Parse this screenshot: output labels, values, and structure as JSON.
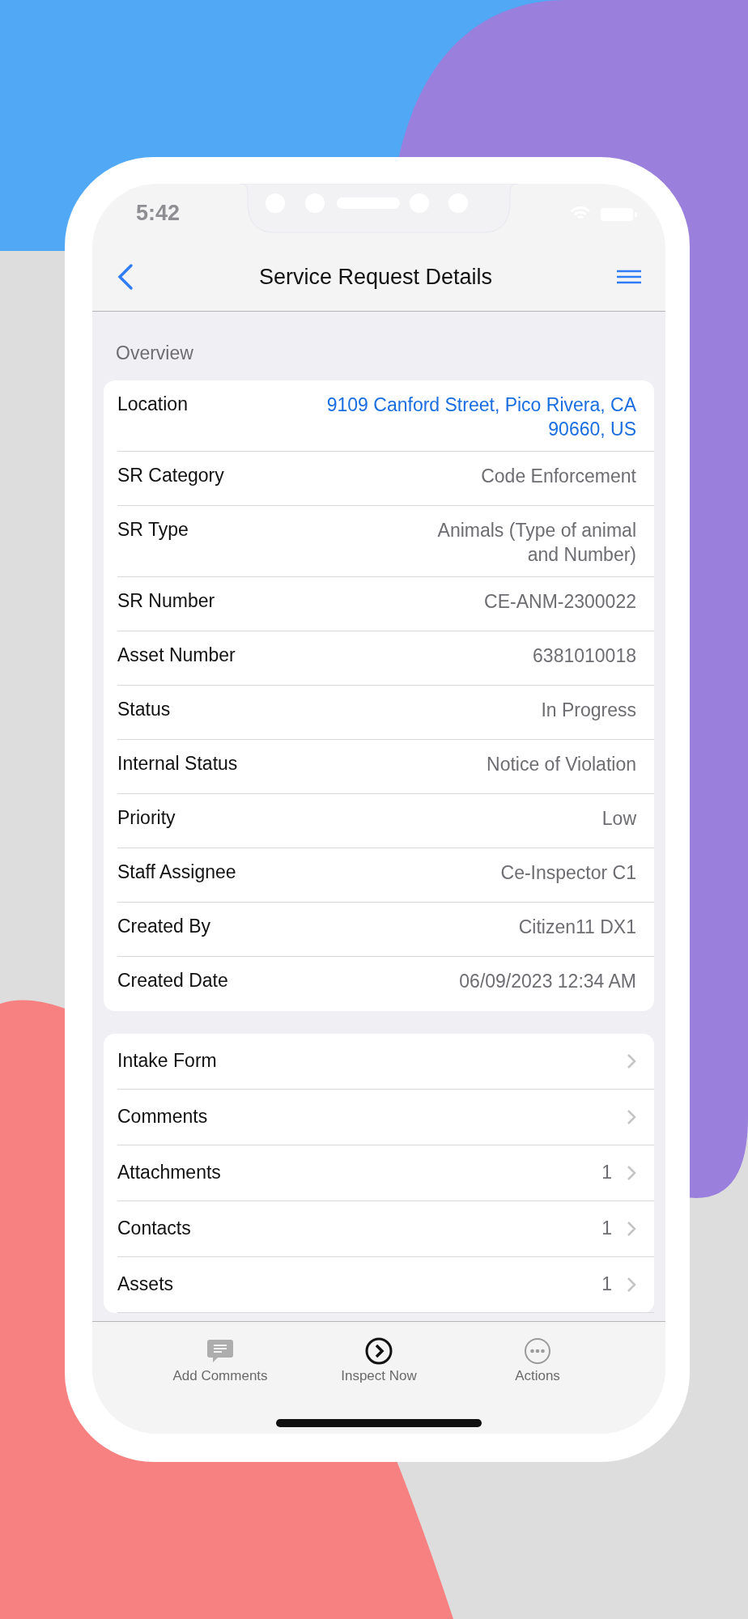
{
  "status_bar": {
    "time": "5:42"
  },
  "header": {
    "title": "Service Request Details"
  },
  "overview": {
    "title": "Overview",
    "rows": [
      {
        "label": "Location",
        "value": "9109 Canford Street, Pico Rivera, CA 90660, US",
        "kind": "link"
      },
      {
        "label": "SR Category",
        "value": "Code Enforcement",
        "kind": "text"
      },
      {
        "label": "SR Type",
        "value": "Animals (Type of animal and Number)",
        "kind": "text"
      },
      {
        "label": "SR Number",
        "value": "CE-ANM-2300022",
        "kind": "text"
      },
      {
        "label": "Asset Number",
        "value": "6381010018",
        "kind": "text"
      },
      {
        "label": "Status",
        "value": "In Progress",
        "kind": "text"
      },
      {
        "label": "Internal Status",
        "value": "Notice of Violation",
        "kind": "text"
      },
      {
        "label": "Priority",
        "value": "Low",
        "kind": "text"
      },
      {
        "label": "Staff Assignee",
        "value": "Ce-Inspector C1",
        "kind": "text"
      },
      {
        "label": "Created By",
        "value": "Citizen11 DX1",
        "kind": "text"
      },
      {
        "label": "Created Date",
        "value": "06/09/2023 12:34 AM",
        "kind": "text"
      }
    ]
  },
  "sections": [
    {
      "label": "Intake Form"
    },
    {
      "label": "Comments"
    },
    {
      "label": "Attachments",
      "count": "1"
    },
    {
      "label": "Contacts",
      "count": "1"
    },
    {
      "label": "Assets",
      "count": "1"
    }
  ],
  "tab_bar": [
    {
      "label": "Add Comments",
      "selected": false
    },
    {
      "label": "Inspect Now",
      "selected": true
    },
    {
      "label": "Actions",
      "selected": false
    }
  ]
}
